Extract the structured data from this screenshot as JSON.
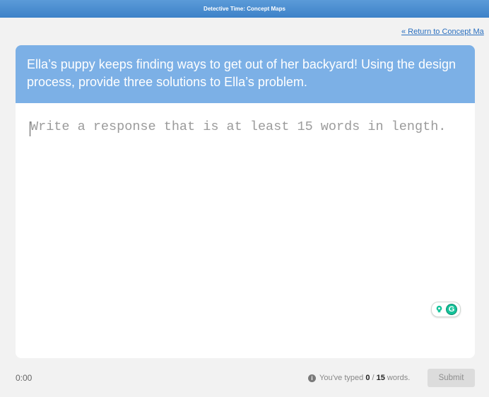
{
  "header": {
    "title": "Detective Time: Concept Maps"
  },
  "nav": {
    "return_link": "« Return to Concept Ma"
  },
  "prompt": {
    "text": "Ella’s puppy keeps finding ways to get out of her backyard! Using the design process, provide three solutions to Ella’s problem."
  },
  "response": {
    "placeholder": "Write a response that is at least 15 words in length.",
    "value": ""
  },
  "grammarly": {
    "letter": "G",
    "icons": [
      "lightbulb-icon",
      "grammarly-icon"
    ]
  },
  "footer": {
    "timer": "0:00",
    "info_icon": "i",
    "word_count_prefix": "You've typed ",
    "typed": "0",
    "required": "15",
    "word_count_suffix": " words.",
    "submit_label": "Submit"
  },
  "colors": {
    "topbar": "#4a8fd2",
    "prompt_bg": "#7cb0e6",
    "link": "#2a6fbf",
    "grammarly_green": "#15c39a"
  }
}
